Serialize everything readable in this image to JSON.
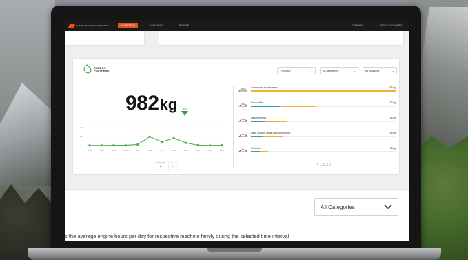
{
  "topnav": {
    "brand": "HUSQVARNA FLEET SERVICES",
    "tabs": [
      "ECOBOARD",
      "MACHINES",
      "PEOPLE"
    ],
    "active_tab": 0,
    "right": [
      "COMPANY ▾",
      "ABOUT ECOBOARD ▾"
    ]
  },
  "carbon": {
    "logo_line1": "CARBON",
    "logo_line2": "FOOTPRINT",
    "value": "982",
    "unit": "kg",
    "delta_label": "-34%",
    "filters": {
      "period": "This year",
      "category": "All categories",
      "location": "All locations"
    },
    "months": [
      "JAN",
      "FEB",
      "MAR",
      "APR",
      "MAY",
      "JUN",
      "JUL",
      "AUG",
      "SEP",
      "OCT",
      "NOV",
      "DEC"
    ],
    "y_ticks": [
      "200",
      "100",
      "0"
    ],
    "pager_prev": "‹",
    "pager_next": "›",
    "machines_pager": "‹ 1 / 2 ›",
    "machines": [
      {
        "name": "Commercial front mowers",
        "value": "578 kg",
        "icon": "front-mower-icon",
        "blue": 0.0,
        "yellow": 1.0
      },
      {
        "name": "Brushcutter",
        "value": "152 kg",
        "icon": "brushcutter-icon",
        "blue": 0.2,
        "yellow": 0.45
      },
      {
        "name": "Hedge trimmer",
        "value": "98 kg",
        "icon": "hedge-trimmer-icon",
        "blue": 0.1,
        "yellow": 0.25
      },
      {
        "name": "Lawn mowers ( Walk-behind mowers )",
        "value": "83 kg",
        "icon": "lawn-mower-icon",
        "blue": 0.08,
        "yellow": 0.22
      },
      {
        "name": "Chainsaw",
        "value": "68 kg",
        "icon": "chainsaw-icon",
        "blue": 0.06,
        "yellow": 0.12
      }
    ]
  },
  "chart_data": {
    "type": "line",
    "x": [
      "JAN",
      "FEB",
      "MAR",
      "APR",
      "MAY",
      "JUN",
      "JUL",
      "AUG",
      "SEP",
      "OCT",
      "NOV",
      "DEC"
    ],
    "values": [
      2,
      2,
      3,
      3,
      12,
      98,
      40,
      82,
      30,
      4,
      2,
      3
    ],
    "ylim": [
      0,
      200
    ],
    "y_ticks": [
      "200",
      "100",
      "0"
    ],
    "color": "#4caf50"
  },
  "bottom": {
    "category_select": "All Categories",
    "description": "s the average engine hours per day for respective machine family during the selected time interval"
  },
  "colors": {
    "accent": "#e0561f",
    "green": "#3c9a3e",
    "bar_blue": "#2ba3c4",
    "bar_yellow": "#f0b12f"
  }
}
